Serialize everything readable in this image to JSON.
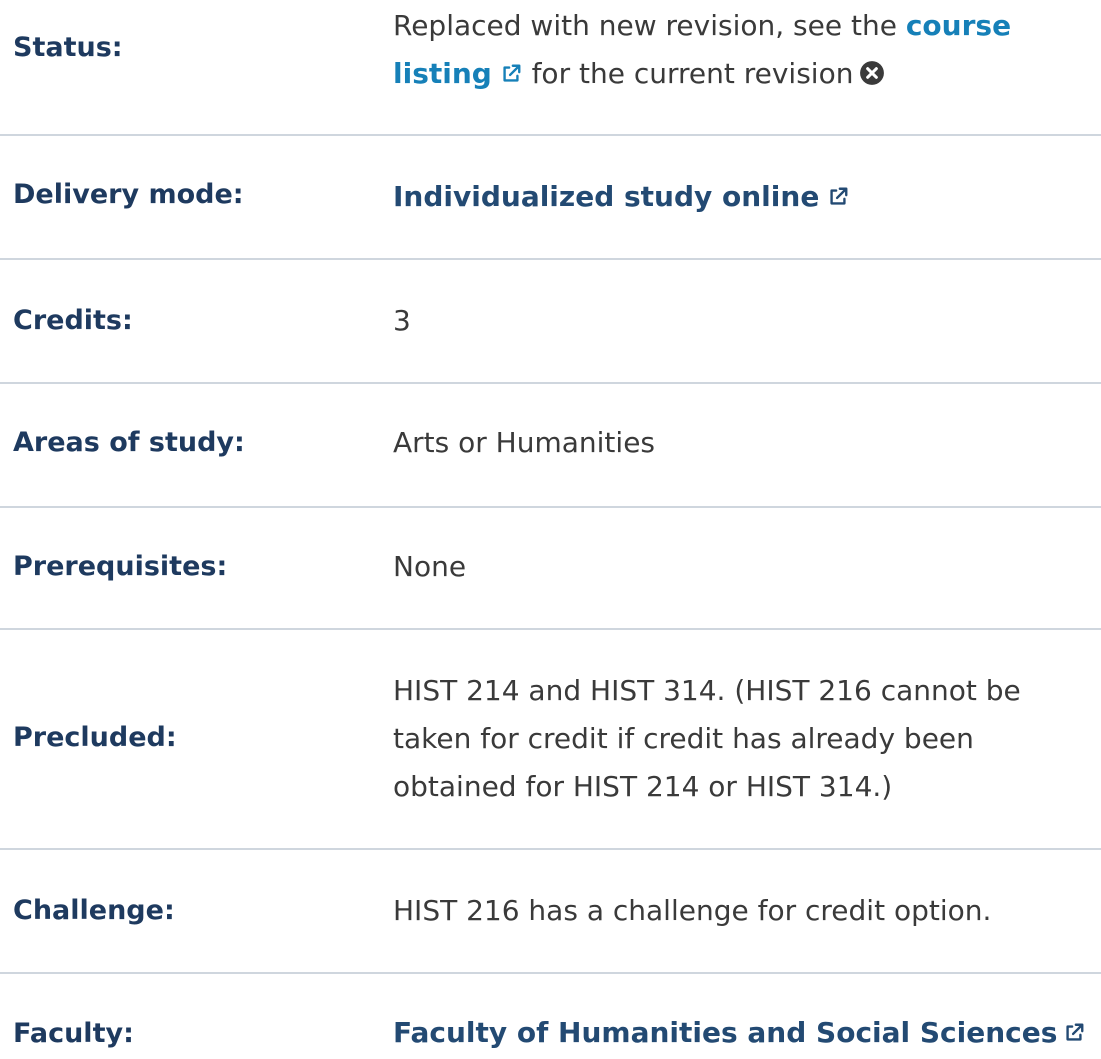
{
  "rows": [
    {
      "label": "Status:",
      "text_before": "Replaced with new revision, see the",
      "link_text": "course listing",
      "text_after": "for the current revision",
      "icons": [
        "external-link-icon",
        "close-circle-icon"
      ]
    },
    {
      "label": "Delivery mode:",
      "value": "Individualized study online",
      "icon": "external-link-icon"
    },
    {
      "label": "Credits:",
      "value": "3"
    },
    {
      "label": "Areas of study:",
      "value": "Arts or Humanities"
    },
    {
      "label": "Prerequisites:",
      "value": "None"
    },
    {
      "label": "Precluded:",
      "value": "HIST 214 and HIST 314. (HIST 216 cannot be taken for credit if credit has already been obtained for HIST 214 or HIST 314.)"
    },
    {
      "label": "Challenge:",
      "value": "HIST 216 has a challenge for credit option."
    },
    {
      "label": "Faculty:",
      "value": "Faculty of Humanities and Social Sciences",
      "icon": "external-link-icon"
    }
  ],
  "colors": {
    "label": "#1e3a5f",
    "link_blue": "#1680b8",
    "link_navy": "#234a73",
    "divider": "#cfd6de",
    "text": "#3a3a3a"
  }
}
